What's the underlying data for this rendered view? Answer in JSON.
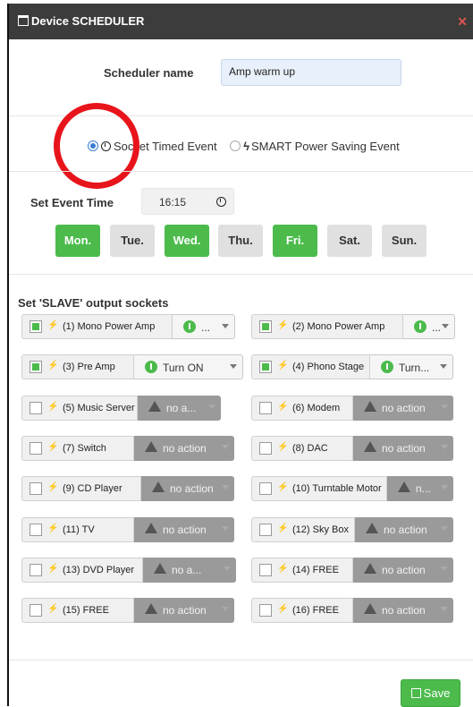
{
  "dialog": {
    "title": "Device SCHEDULER",
    "close_glyph": "✕"
  },
  "scheduler": {
    "label": "Scheduler name",
    "value": "Amp warm up"
  },
  "event_type": {
    "options": [
      {
        "label": "Socket Timed Event",
        "selected": true,
        "icon": "clock-icon"
      },
      {
        "label": "SMART Power Saving Event",
        "selected": false,
        "icon": "bolt-icon"
      }
    ]
  },
  "event_time": {
    "label": "Set Event Time",
    "value": "16:15"
  },
  "days": [
    {
      "label": "Mon.",
      "active": true
    },
    {
      "label": "Tue.",
      "active": false
    },
    {
      "label": "Wed.",
      "active": true
    },
    {
      "label": "Thu.",
      "active": false
    },
    {
      "label": "Fri.",
      "active": true
    },
    {
      "label": "Sat.",
      "active": false
    },
    {
      "label": "Sun.",
      "active": false
    }
  ],
  "slave_title": "Set 'SLAVE' output sockets",
  "sockets": [
    {
      "label": "(1) Mono Power Amp",
      "checked": true,
      "action": "...",
      "action_on": true
    },
    {
      "label": "(2) Mono Power Amp",
      "checked": true,
      "action": "...",
      "action_on": true
    },
    {
      "label": "(3) Pre Amp",
      "checked": true,
      "action": "Turn ON",
      "action_on": true
    },
    {
      "label": "(4) Phono Stage",
      "checked": true,
      "action": "Turn...",
      "action_on": true
    },
    {
      "label": "(5) Music Server",
      "checked": false,
      "action": "no a...",
      "action_on": false
    },
    {
      "label": "(6) Modem",
      "checked": false,
      "action": "no action",
      "action_on": false
    },
    {
      "label": "(7) Switch",
      "checked": false,
      "action": "no action",
      "action_on": false
    },
    {
      "label": "(8) DAC",
      "checked": false,
      "action": "no action",
      "action_on": false
    },
    {
      "label": "(9) CD Player",
      "checked": false,
      "action": "no action",
      "action_on": false
    },
    {
      "label": "(10) Turntable Motor",
      "checked": false,
      "action": "n...",
      "action_on": false
    },
    {
      "label": "(11) TV",
      "checked": false,
      "action": "no action",
      "action_on": false
    },
    {
      "label": "(12) Sky Box",
      "checked": false,
      "action": "no action",
      "action_on": false
    },
    {
      "label": "(13) DVD Player",
      "checked": false,
      "action": "no a...",
      "action_on": false
    },
    {
      "label": "(14) FREE",
      "checked": false,
      "action": "no action",
      "action_on": false
    },
    {
      "label": "(15) FREE",
      "checked": false,
      "action": "no action",
      "action_on": false
    },
    {
      "label": "(16) FREE",
      "checked": false,
      "action": "no action",
      "action_on": false
    }
  ],
  "save_label": "Save",
  "colors": {
    "accent_green": "#4cbb4c",
    "radio_blue": "#3a7bd5",
    "annotation_red": "#e8141b",
    "titlebar": "#3c3c3c"
  }
}
